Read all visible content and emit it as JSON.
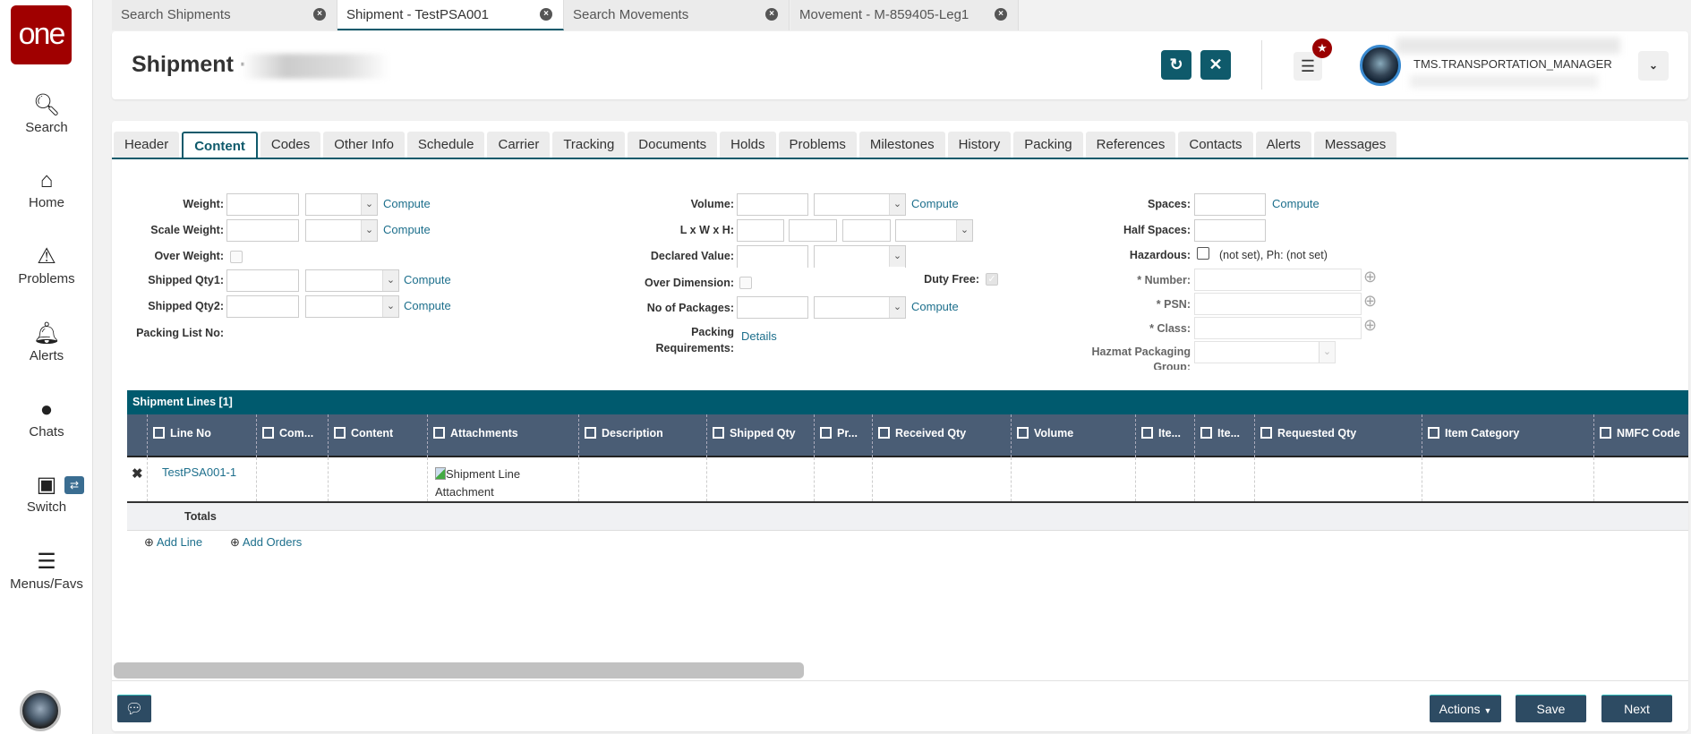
{
  "sidebar": {
    "logo": "one",
    "items": [
      {
        "label": "Search",
        "icon": "search-icon"
      },
      {
        "label": "Home",
        "icon": "home-icon"
      },
      {
        "label": "Problems",
        "icon": "warning-icon"
      },
      {
        "label": "Alerts",
        "icon": "bell-icon"
      },
      {
        "label": "Chats",
        "icon": "chat-icon"
      },
      {
        "label": "Switch",
        "icon": "switch-icon"
      },
      {
        "label": "Menus/Favs",
        "icon": "menu-icon"
      }
    ]
  },
  "tabs": [
    {
      "label": "Search Shipments",
      "active": false
    },
    {
      "label": "Shipment - TestPSA001",
      "active": true
    },
    {
      "label": "Search Movements",
      "active": false
    },
    {
      "label": "Movement - M-859405-Leg1",
      "active": false
    }
  ],
  "header": {
    "title": "Shipment ·",
    "user_role": "TMS.TRANSPORTATION_MANAGER"
  },
  "colors": {
    "accent": "#0f5a6b",
    "grid_title": "#005a6e",
    "grid_header": "#4a5d75",
    "button": "#2d4b63",
    "logo": "#a00000"
  },
  "main_tabs": [
    "Header",
    "Content",
    "Codes",
    "Other Info",
    "Schedule",
    "Carrier",
    "Tracking",
    "Documents",
    "Holds",
    "Problems",
    "Milestones",
    "History",
    "Packing",
    "References",
    "Contacts",
    "Alerts",
    "Messages"
  ],
  "active_tab": "Content",
  "form": {
    "weight": "Weight:",
    "scale_weight": "Scale Weight:",
    "over_weight": "Over Weight:",
    "shipped_qty1": "Shipped Qty1:",
    "shipped_qty2": "Shipped Qty2:",
    "packing_list_no": "Packing List No:",
    "volume": "Volume:",
    "lwh": "L x W x H:",
    "declared_value": "Declared Value:",
    "over_dimension": "Over Dimension:",
    "duty_free": "Duty Free:",
    "no_of_packages": "No of Packages:",
    "packing_req_1": "Packing",
    "packing_req_2": "Requirements:",
    "details": "Details",
    "spaces": "Spaces:",
    "half_spaces": "Half Spaces:",
    "hazardous": "Hazardous:",
    "hazardous_text": "(not set), Ph: (not set)",
    "number": "* Number:",
    "psn": "* PSN:",
    "class": "* Class:",
    "hazmat_pkg": "Hazmat Packaging",
    "hazmat_pkg2": "Group:",
    "compute": "Compute",
    "duty_free_checked": true
  },
  "grid": {
    "title": "Shipment Lines [1]",
    "columns": [
      "",
      "Line No",
      "Com...",
      "Content",
      "Attachments",
      "Description",
      "Shipped Qty",
      "Pr...",
      "Received Qty",
      "Volume",
      "Ite...",
      "Ite...",
      "Requested Qty",
      "Item Category",
      "NMFC Code"
    ],
    "rows": [
      {
        "line_no": "TestPSA001-1",
        "attachment": "Shipment Line Attachment"
      }
    ],
    "totals": "Totals",
    "add_line": "Add Line",
    "add_orders": "Add Orders"
  },
  "footer": {
    "actions": "Actions",
    "save": "Save",
    "next": "Next"
  }
}
